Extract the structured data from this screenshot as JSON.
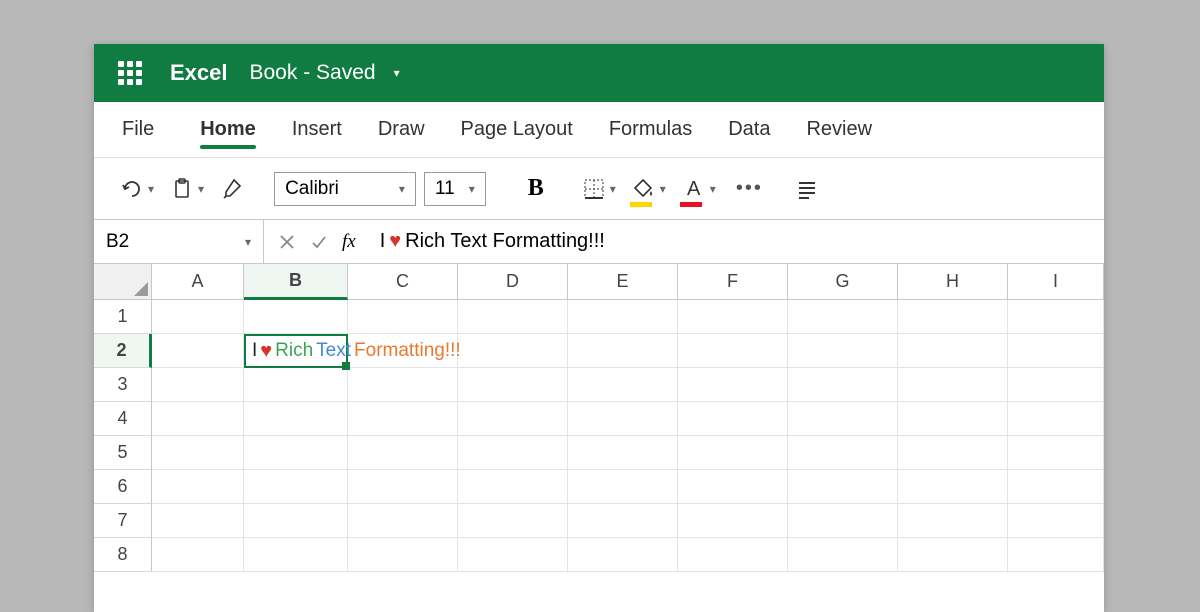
{
  "app": {
    "name": "Excel",
    "document": "Book - Saved"
  },
  "tabs": [
    "File",
    "Home",
    "Insert",
    "Draw",
    "Page Layout",
    "Formulas",
    "Data",
    "Review"
  ],
  "activeTab": 1,
  "toolbar": {
    "font": "Calibri",
    "size": "11",
    "bold": "B"
  },
  "formulaBar": {
    "reference": "B2",
    "fx": "fx",
    "parts": {
      "i": "I",
      "rich": "Rich",
      "text": "Text",
      "formatting": "Formatting!!!",
      "plainTail": "Rich Text Formatting!!!"
    }
  },
  "columns": [
    "A",
    "B",
    "C",
    "D",
    "E",
    "F",
    "G",
    "H",
    "I"
  ],
  "rows": [
    "1",
    "2",
    "3",
    "4",
    "5",
    "6",
    "7",
    "8"
  ],
  "selectedCol": 1,
  "selectedRow": 1,
  "cellContent": {
    "i": "I",
    "rich": "Rich",
    "text": "Text",
    "formatting": "Formatting!!!"
  },
  "colors": {
    "brand": "#107c41",
    "fillAccent": "#ffd500",
    "fontAccent": "#e81123"
  }
}
